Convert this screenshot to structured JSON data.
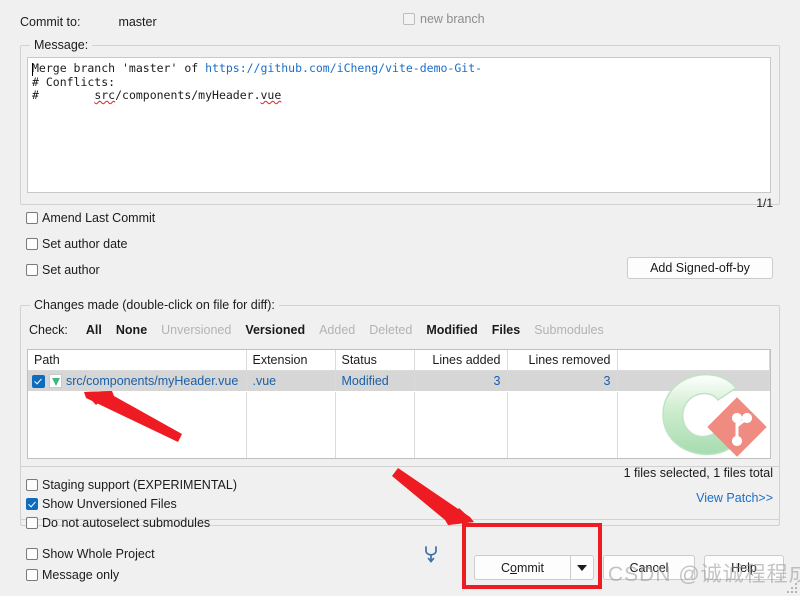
{
  "header": {
    "commit_to_label": "Commit to:",
    "branch_name": "master",
    "new_branch_label": "new branch",
    "new_branch_checked": false,
    "new_branch_disabled": true
  },
  "message_group": {
    "legend": "Message:",
    "line1_prefix": "Merge branch 'master' of ",
    "line1_url": "https://github.com/iCheng/vite-demo-Git-",
    "line3": "# Conflicts:",
    "line4_prefix": "#        ",
    "line4_path_a": "src",
    "line4_path_b": "/components/myHeader.",
    "line4_path_c": "vue",
    "counter": "1/1",
    "options": [
      {
        "label": "Amend Last Commit",
        "checked": false
      },
      {
        "label": "Set author date",
        "checked": false
      },
      {
        "label": "Set author",
        "checked": false
      }
    ],
    "add_signed_off_by": "Add Signed-off-by"
  },
  "changes_group": {
    "legend": "Changes made (double-click on file for diff):",
    "check_label": "Check:",
    "check_links": [
      {
        "label": "All",
        "enabled": true
      },
      {
        "label": "None",
        "enabled": true
      },
      {
        "label": "Unversioned",
        "enabled": false
      },
      {
        "label": "Versioned",
        "enabled": true
      },
      {
        "label": "Added",
        "enabled": false
      },
      {
        "label": "Deleted",
        "enabled": false
      },
      {
        "label": "Modified",
        "enabled": true
      },
      {
        "label": "Files",
        "enabled": true
      },
      {
        "label": "Submodules",
        "enabled": false
      }
    ],
    "columns": [
      "Path",
      "Extension",
      "Status",
      "Lines added",
      "Lines removed"
    ],
    "rows": [
      {
        "checked": true,
        "icon": "vue-file-icon",
        "path": "src/components/myHeader.vue",
        "extension": ".vue",
        "status": "Modified",
        "lines_added": "3",
        "lines_removed": "3",
        "selected": true
      }
    ],
    "files_total": "1 files selected, 1 files total",
    "view_patch": "View Patch>>"
  },
  "bottom_options": {
    "group": [
      {
        "label": "Staging support (EXPERIMENTAL)",
        "checked": false
      },
      {
        "label": "Show Unversioned Files",
        "checked": true
      },
      {
        "label": "Do not autoselect submodules",
        "checked": false
      }
    ],
    "outside": [
      {
        "label": "Show Whole Project",
        "checked": false
      },
      {
        "label": "Message only",
        "checked": false
      }
    ]
  },
  "buttons": {
    "commit": "Commit",
    "commit_mnemonic": "o",
    "cancel": "Cancel",
    "help": "Help",
    "dropdown_icon": "chevron-down-icon"
  },
  "annotations": {
    "highlight_color": "#ee1c22",
    "arrow_count": 2
  },
  "watermark": {
    "text": "CSDN @诚诚程程成"
  },
  "colors": {
    "accent_blue": "#0f6cbd",
    "link_blue": "#1a6fc9",
    "table_text": "#1a5fa8",
    "window_bg": "#f0f0f0",
    "annotation_red": "#ee1c22"
  }
}
